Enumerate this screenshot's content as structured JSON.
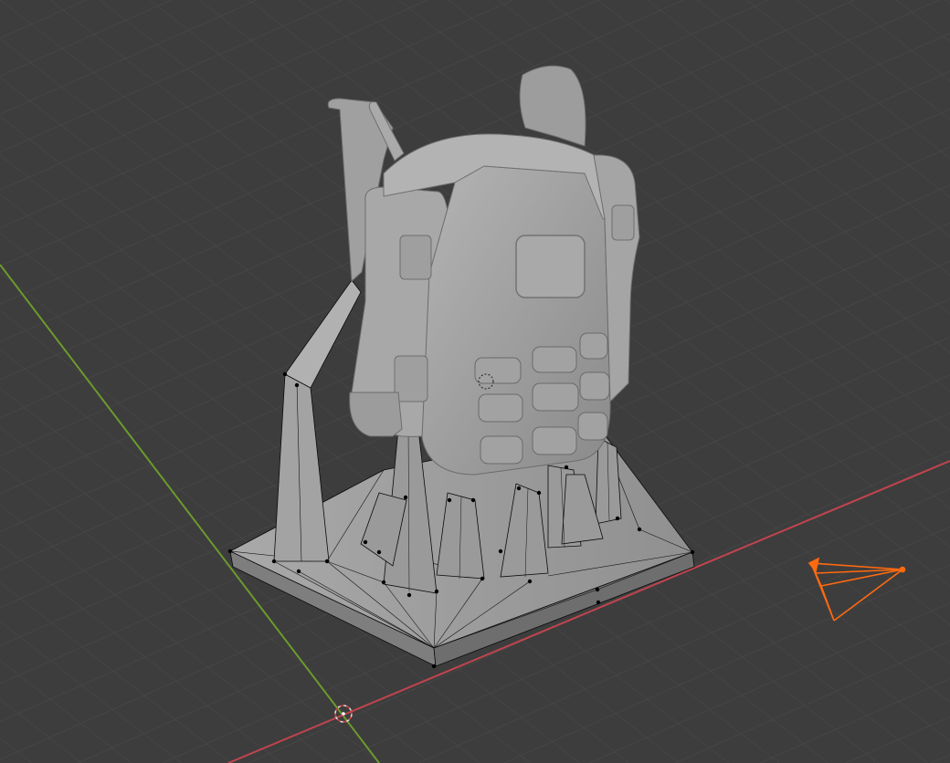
{
  "viewport": {
    "view": "3D Viewport",
    "shading": "solid",
    "colors": {
      "background": "#3d3d3d",
      "grid_line": "#4a4a4a",
      "x_axis": "#c0444e",
      "y_axis": "#6b9a2e",
      "camera": "#ff6a10",
      "mesh": "#9c9c9c",
      "wire": "#0a0a0a"
    },
    "objects": [
      {
        "type": "mesh",
        "name_icon": "mesh-object"
      },
      {
        "type": "camera",
        "name_icon": "camera-icon"
      },
      {
        "type": "3d-cursor",
        "name_icon": "cursor-icon"
      }
    ]
  }
}
